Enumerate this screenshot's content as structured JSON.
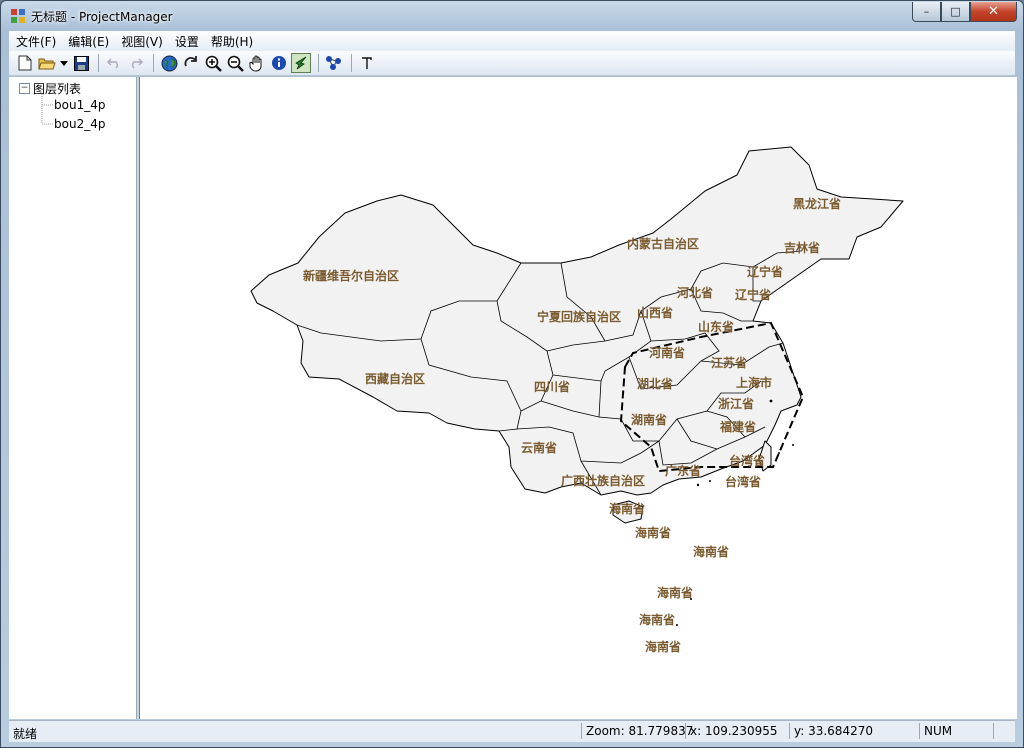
{
  "window": {
    "title": "无标题 - ProjectManager",
    "icon": "app-icon",
    "buttons": {
      "minimize": "–",
      "maximize": "□",
      "close": "✕"
    }
  },
  "menu": [
    {
      "label": "文件(F)"
    },
    {
      "label": "编辑(E)"
    },
    {
      "label": "视图(V)"
    },
    {
      "label": "设置"
    },
    {
      "label": "帮助(H)"
    }
  ],
  "toolbar": {
    "buttons": [
      "new-file-icon",
      "open-folder-icon",
      "dropdown-arrow-icon",
      "save-icon",
      "undo-icon",
      "redo-icon",
      "globe-icon",
      "refresh-icon",
      "zoom-in-icon",
      "zoom-out-icon",
      "pan-hand-icon",
      "info-icon",
      "select-tool-icon",
      "network-icon",
      "text-tool-icon"
    ],
    "active": "select-tool-icon"
  },
  "layer_tree": {
    "root": "图层列表",
    "expander": "−",
    "layers": [
      "bou1_4p",
      "bou2_4p"
    ]
  },
  "map": {
    "labels": [
      "黑龙江省",
      "内蒙古自治区",
      "吉林省",
      "辽宁省",
      "新疆维吾尔自治区",
      "河北省",
      "辽宁省",
      "宁夏回族自治区",
      "山西省",
      "山东省",
      "河南省",
      "江苏省",
      "西藏自治区",
      "四川省",
      "湖北省",
      "上海市",
      "浙江省",
      "湖南省",
      "福建省",
      "云南省",
      "台湾省",
      "广东省",
      "广西壮族自治区",
      "台湾省",
      "海南省",
      "海南省",
      "海南省",
      "海南省",
      "海南省",
      "海南省"
    ],
    "fill_color": "#f2f2f2",
    "selection": "dashed polygon"
  },
  "status": {
    "ready": "就绪",
    "zoom": "Zoom: 81.779837",
    "x": "x: 109.230955",
    "y": "y: 33.684270",
    "num": "NUM"
  }
}
